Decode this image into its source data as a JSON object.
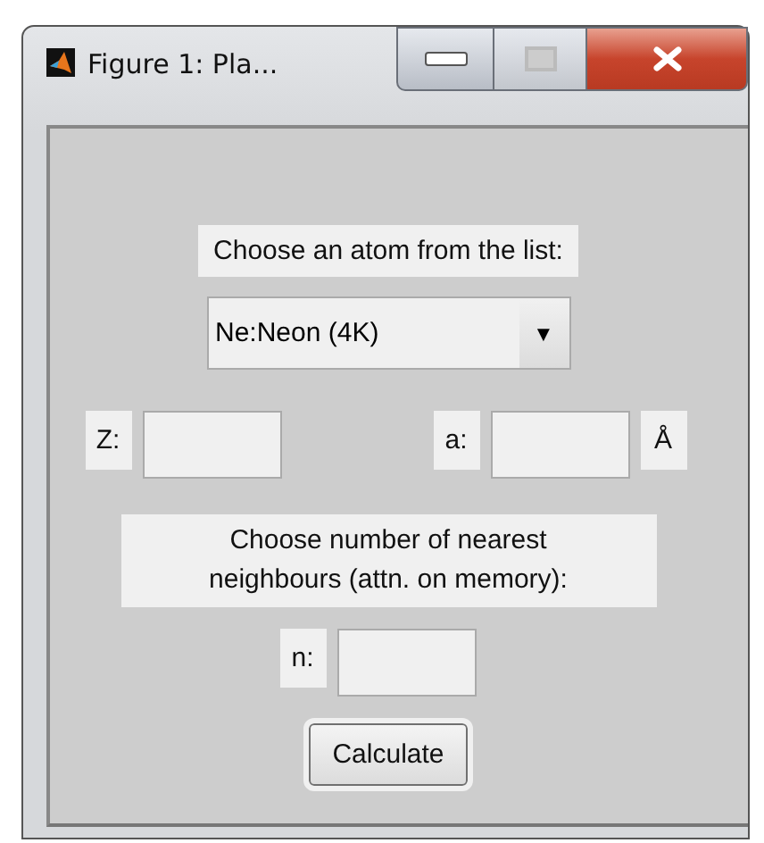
{
  "window": {
    "title": "Figure 1: Pla..."
  },
  "atom_prompt": "Choose an atom from the list:",
  "atom_select": {
    "value": "Ne:Neon (4K)",
    "arrow": "▼"
  },
  "z_field": {
    "label": "Z:"
  },
  "a_field": {
    "label": "a:",
    "unit": "Å"
  },
  "neighbours_prompt": "Choose number of nearest neighbours (attn. on memory):",
  "n_field": {
    "label": "n:"
  },
  "buttons": [
    "Calculate"
  ]
}
